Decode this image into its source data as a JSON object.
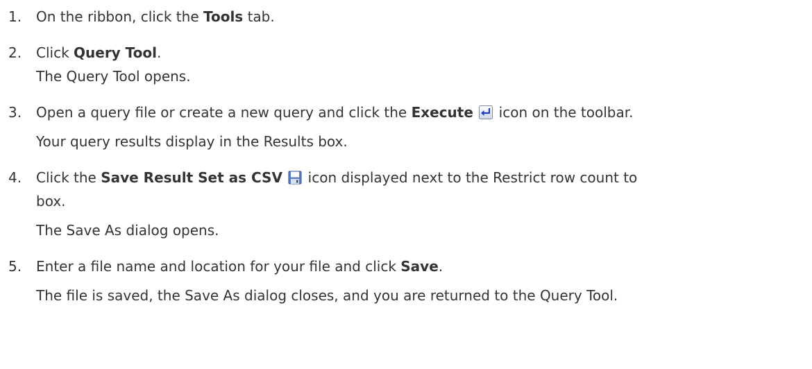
{
  "steps": [
    {
      "number": "1.",
      "before": "On the ribbon, click the ",
      "bold": "Tools",
      "after": " tab."
    },
    {
      "number": "2.",
      "before": "Click ",
      "bold": "Query Tool",
      "after": ".",
      "note": "The Query Tool opens."
    },
    {
      "number": "3.",
      "before": "Open a query file or create a new query and click the ",
      "bold": "Execute",
      "icon": "execute-icon",
      "after": " icon on the toolbar.",
      "note": "Your query results display in the Results box."
    },
    {
      "number": "4.",
      "before": "Click the ",
      "bold": "Save Result Set as CSV",
      "icon": "save-icon",
      "after": " icon displayed next to the Restrict row count to",
      "after2": "box.",
      "note": "The Save As dialog opens."
    },
    {
      "number": "5.",
      "before": "Enter a file name and location for your file and click ",
      "bold": "Save",
      "after": ".",
      "note": "The file is saved, the Save As dialog closes, and you are returned to the Query Tool."
    }
  ]
}
